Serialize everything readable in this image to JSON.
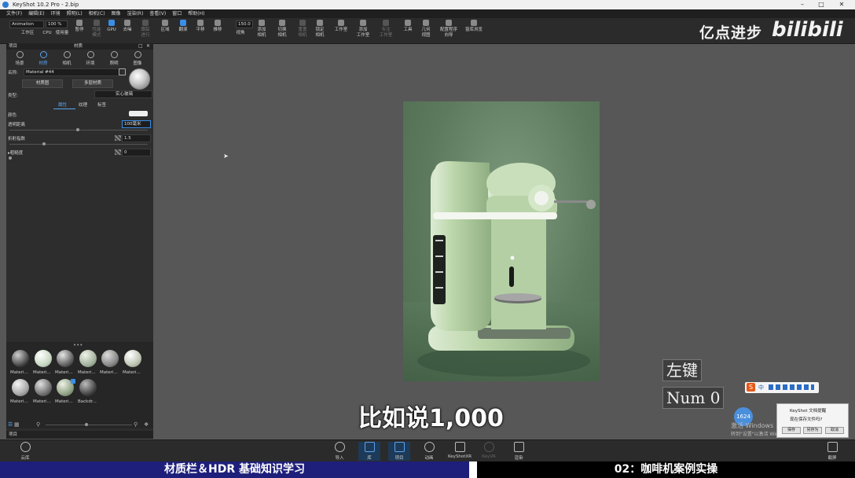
{
  "window": {
    "title": "KeyShot 10.2 Pro - 2.bip",
    "minimize": "–",
    "maximize": "□",
    "close": "✕"
  },
  "menu": [
    "文件(F)",
    "编辑(E)",
    "环境",
    "照明(L)",
    "相机(C)",
    "图像",
    "渲染(R)",
    "查看(V)",
    "窗口",
    "帮助(H)"
  ],
  "toolbar": {
    "preset": "Animation",
    "zoom": "100 %",
    "fov": "150.0",
    "workspace": "工作区",
    "cpu": "CPU",
    "usage": "使用量",
    "pause": "暂停",
    "perf": "性能\n模式",
    "gpu": "GPU",
    "denoise": "去噪",
    "trackball": "跟踪\n进行",
    "region": "区域",
    "tumble": "翻滚",
    "pan": "平移",
    "dolly": "推移",
    "view": "视角",
    "add_camera": "添加\n相机",
    "switch_camera": "切换\n相机",
    "reset_camera": "重置\n相机",
    "lock_camera": "锁定\n相机",
    "studio": "工作室",
    "add_studio": "添加\n工作室",
    "studio_manager": "专注\n工作室",
    "tools": "工具",
    "geometry_view": "几何\n视图",
    "config_wizard": "配置程序\n向导",
    "material_browser": "窗库浏览"
  },
  "watermark": {
    "text": "亿点进步",
    "brand": "bilibili"
  },
  "panel": {
    "header_left": "项目",
    "header_center": "材质",
    "tabs": [
      "场景",
      "材质",
      "相机",
      "环境",
      "照明",
      "图像"
    ],
    "name_label": "名称:",
    "name_value": "Material #44",
    "material_graph_btn": "材质图",
    "multi_material_btn": "多层材质",
    "type_label": "类型:",
    "type_value": "实心玻璃",
    "subtabs": [
      "属性",
      "纹理",
      "标签"
    ],
    "color_label": "颜色",
    "transparency_label": "透明距离",
    "transparency_value": "100毫米",
    "ior_label": "折射指数",
    "ior_value": "1.5",
    "roughness_label": "粗糙度",
    "roughness_value": "0",
    "library_items": [
      "Materi...",
      "Materi...",
      "Materi...",
      "Materi...",
      "Materi...",
      "Materi...",
      "Materi...",
      "Materi...",
      "Materi...",
      "Backdr..."
    ],
    "bottom_tab": "项目"
  },
  "overlay": {
    "key1": "左键",
    "key2": "Num 0"
  },
  "subtitle": "比如说1,000",
  "dock": [
    "云库",
    "导入",
    "库",
    "项目",
    "动画",
    "KeyShotXR",
    "KeyVR",
    "渲染",
    "截屏"
  ],
  "dialog": {
    "title": "KeyShot 文档提醒",
    "text": "现在保存文件吗?",
    "btn1": "保存",
    "btn2": "另存为",
    "btn3": "取消"
  },
  "clock": "1624",
  "activation": {
    "line1": "激活 Windows",
    "line2": "转到\"设置\"以激活 Windows。"
  },
  "ime": "中",
  "banner": {
    "left": "材质栏＆HDR 基础知识学习",
    "right": "02：咖啡机案例实操"
  },
  "colors": {
    "accent": "#3a8ee6",
    "machine": "#b9d6a8",
    "backdrop": "#5d7a5e",
    "banner": "#1e1f7a"
  }
}
